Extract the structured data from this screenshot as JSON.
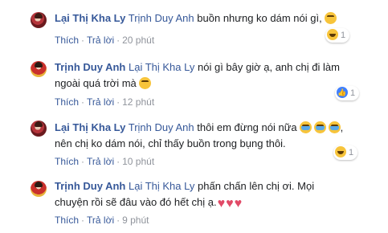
{
  "comments": [
    {
      "author": "Lại Thị Kha Ly",
      "tag": "Trịnh Duy Anh",
      "line1": "buồn nhưng ko dám nói gì,",
      "line2": "",
      "emojis": [
        "sad-emoji"
      ],
      "reaction": {
        "icon": "haha-icon",
        "count": "1"
      },
      "time": "20 phút"
    },
    {
      "author": "Trịnh Duy Anh",
      "tag": "Lại Thị Kha Ly",
      "line1": "nói gì bây giờ ạ, anh chị đi làm",
      "line2": "ngoài quá trời mà",
      "emojis": [
        "laugh-emoji"
      ],
      "reaction": {
        "icon": "like-icon",
        "count": "1"
      },
      "time": "12 phút"
    },
    {
      "author": "Lại Thị Kha Ly",
      "tag": "Trịnh Duy Anh",
      "line1": "thôi em đừng nói nữa",
      "line2": "nên chị ko dám nói, chỉ thấy buồn trong bụng thôi.",
      "emojis": [
        "cry-emoji",
        "cry-emoji",
        "cry-emoji"
      ],
      "reaction": {
        "icon": "haha-icon",
        "count": "1"
      },
      "time": "10 phút"
    },
    {
      "author": "Trịnh Duy Anh",
      "tag": "Lại Thị Kha Ly",
      "line1": "phấn chấn lên chị ơi. Mọi",
      "line2": "chuyện rồi sẽ đâu vào đó hết chị ạ.",
      "emojis": [
        "heart-icon",
        "heart-icon",
        "heart-icon"
      ],
      "reaction": null,
      "time": "9 phút"
    }
  ],
  "actions": {
    "like": "Thích",
    "reply": "Trả lời",
    "separator": "·"
  }
}
